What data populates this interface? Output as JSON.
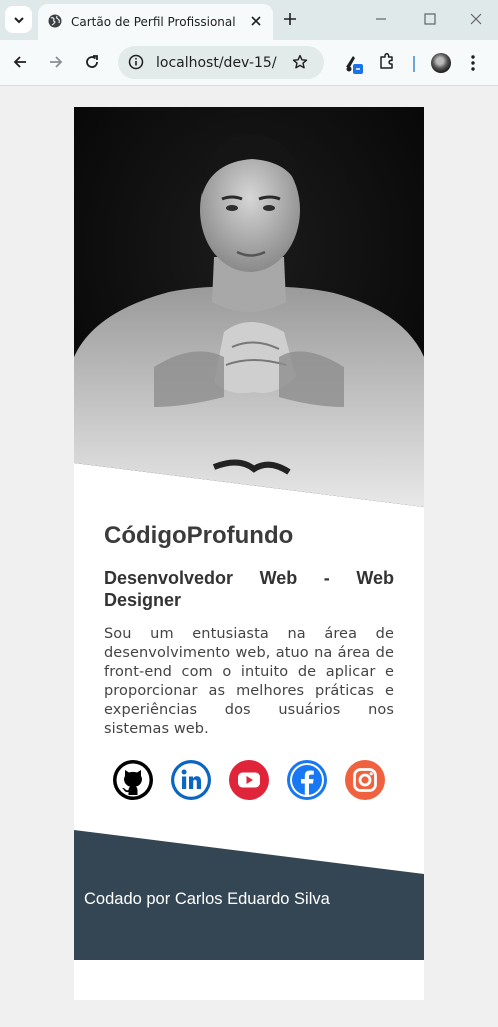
{
  "browser": {
    "tab_title": "Cartão de Perfil Profissional",
    "url": "localhost/dev-15/"
  },
  "profile": {
    "name": "CódigoProfundo",
    "role": "Desenvolvedor Web - Web Designer",
    "bio": "Sou um entusiasta na área de desenvolvimento web, atuo na área de front-end com o intuito de aplicar e proporcionar as melhores práticas e experiências dos usuários nos sistemas web.",
    "photo_icon": "portrait-photo"
  },
  "socials": [
    {
      "name": "github",
      "icon": "github-icon",
      "color": "#000000"
    },
    {
      "name": "linkedin",
      "icon": "linkedin-icon",
      "color": "#0a66c2"
    },
    {
      "name": "youtube",
      "icon": "youtube-icon",
      "color": "#e0243a"
    },
    {
      "name": "facebook",
      "icon": "facebook-icon",
      "color": "#1877f2"
    },
    {
      "name": "instagram",
      "icon": "instagram-icon",
      "color": "#f0623f"
    }
  ],
  "footer": {
    "credit": "Codado por Carlos Eduardo Silva",
    "background": "#344653"
  }
}
